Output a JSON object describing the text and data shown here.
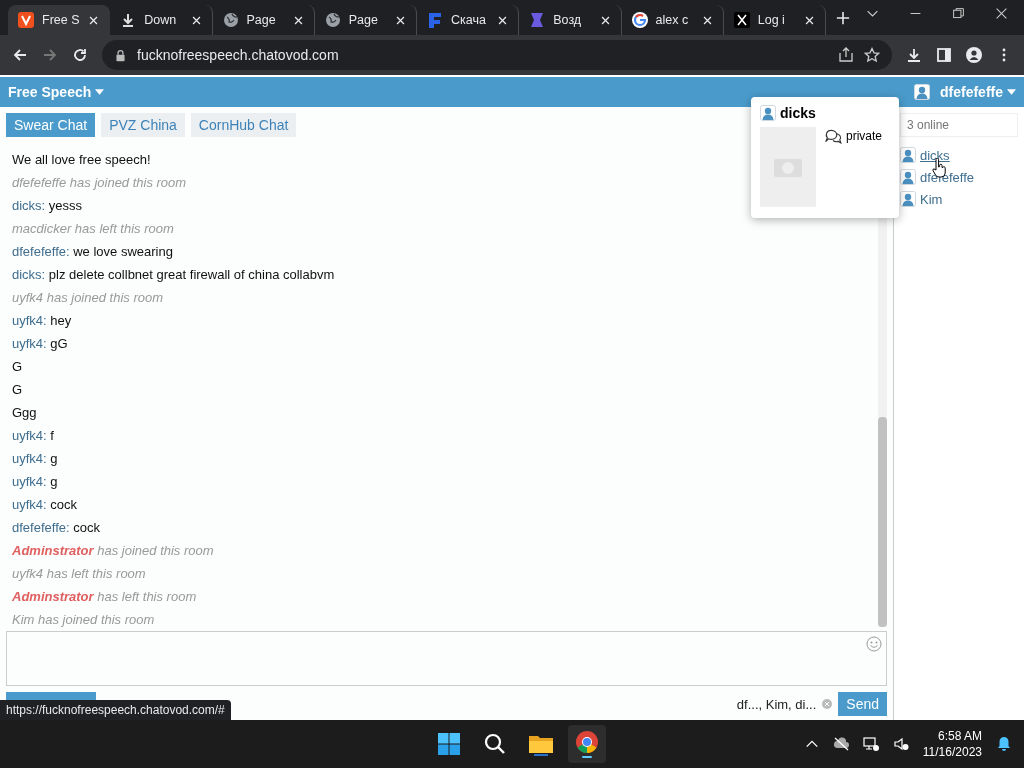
{
  "browser": {
    "tabs": [
      {
        "title": "Free S",
        "kind": "orange",
        "selected": true
      },
      {
        "title": "Down",
        "kind": "download",
        "selected": false
      },
      {
        "title": "Page",
        "kind": "globe",
        "selected": false
      },
      {
        "title": "Page",
        "kind": "globe",
        "selected": false
      },
      {
        "title": "Скача",
        "kind": "blue",
        "selected": false
      },
      {
        "title": "Возд",
        "kind": "purple",
        "selected": false
      },
      {
        "title": "alex c",
        "kind": "google",
        "selected": false
      },
      {
        "title": "Log i",
        "kind": "x",
        "selected": false
      }
    ],
    "url": "fucknofreespeech.chatovod.com"
  },
  "header": {
    "title": "Free Speech",
    "user": "dfefefeffe"
  },
  "rooms": [
    {
      "label": "Swear Chat",
      "selected": true
    },
    {
      "label": "PVZ China",
      "selected": false
    },
    {
      "label": "CornHub Chat",
      "selected": false
    }
  ],
  "messages": [
    {
      "kind": "plain",
      "text": "We all love free speech!"
    },
    {
      "kind": "event",
      "text": "dfefefeffe has joined this room"
    },
    {
      "kind": "message",
      "author": "dicks:",
      "text": "yesss"
    },
    {
      "kind": "event",
      "text": "macdicker has left this room"
    },
    {
      "kind": "message",
      "author": "dfefefeffe:",
      "text": "we love swearing"
    },
    {
      "kind": "message",
      "author": "dicks:",
      "text": "plz delete collbnet great firewall of china collabvm"
    },
    {
      "kind": "event",
      "text": "uyfk4 has joined this room"
    },
    {
      "kind": "message",
      "author": "uyfk4:",
      "text": "hey"
    },
    {
      "kind": "message",
      "author": "uyfk4:",
      "text": "gG"
    },
    {
      "kind": "plain",
      "text": "G"
    },
    {
      "kind": "plain",
      "text": "G"
    },
    {
      "kind": "plain",
      "text": "Ggg"
    },
    {
      "kind": "message",
      "author": "uyfk4:",
      "text": "f"
    },
    {
      "kind": "message",
      "author": "uyfk4:",
      "text": "g"
    },
    {
      "kind": "message",
      "author": "uyfk4:",
      "text": "g"
    },
    {
      "kind": "message",
      "author": "uyfk4:",
      "text": "cock"
    },
    {
      "kind": "message",
      "author": "dfefefeffe:",
      "text": "cock"
    },
    {
      "kind": "admin_event",
      "author": "Adminstrator",
      "text": "has joined this room"
    },
    {
      "kind": "event",
      "text": "uyfk4 has left this room"
    },
    {
      "kind": "admin_event",
      "author": "Adminstrator",
      "text": "has left this room"
    },
    {
      "kind": "event",
      "text": "Kim has joined this room"
    }
  ],
  "composer": {
    "recipients": "df..., Kim, di...",
    "send": "Send"
  },
  "sidebar": {
    "placeholder": "3 online",
    "users": [
      {
        "name": "dicks",
        "hovered": true
      },
      {
        "name": "dfefefeffe",
        "hovered": false
      },
      {
        "name": "Kim",
        "hovered": false
      }
    ]
  },
  "popup": {
    "name": "dicks",
    "action": "private"
  },
  "status_url": "https://fucknofreespeech.chatovod.com/#",
  "taskbar": {
    "time": "6:58 AM",
    "date": "11/16/2023"
  }
}
